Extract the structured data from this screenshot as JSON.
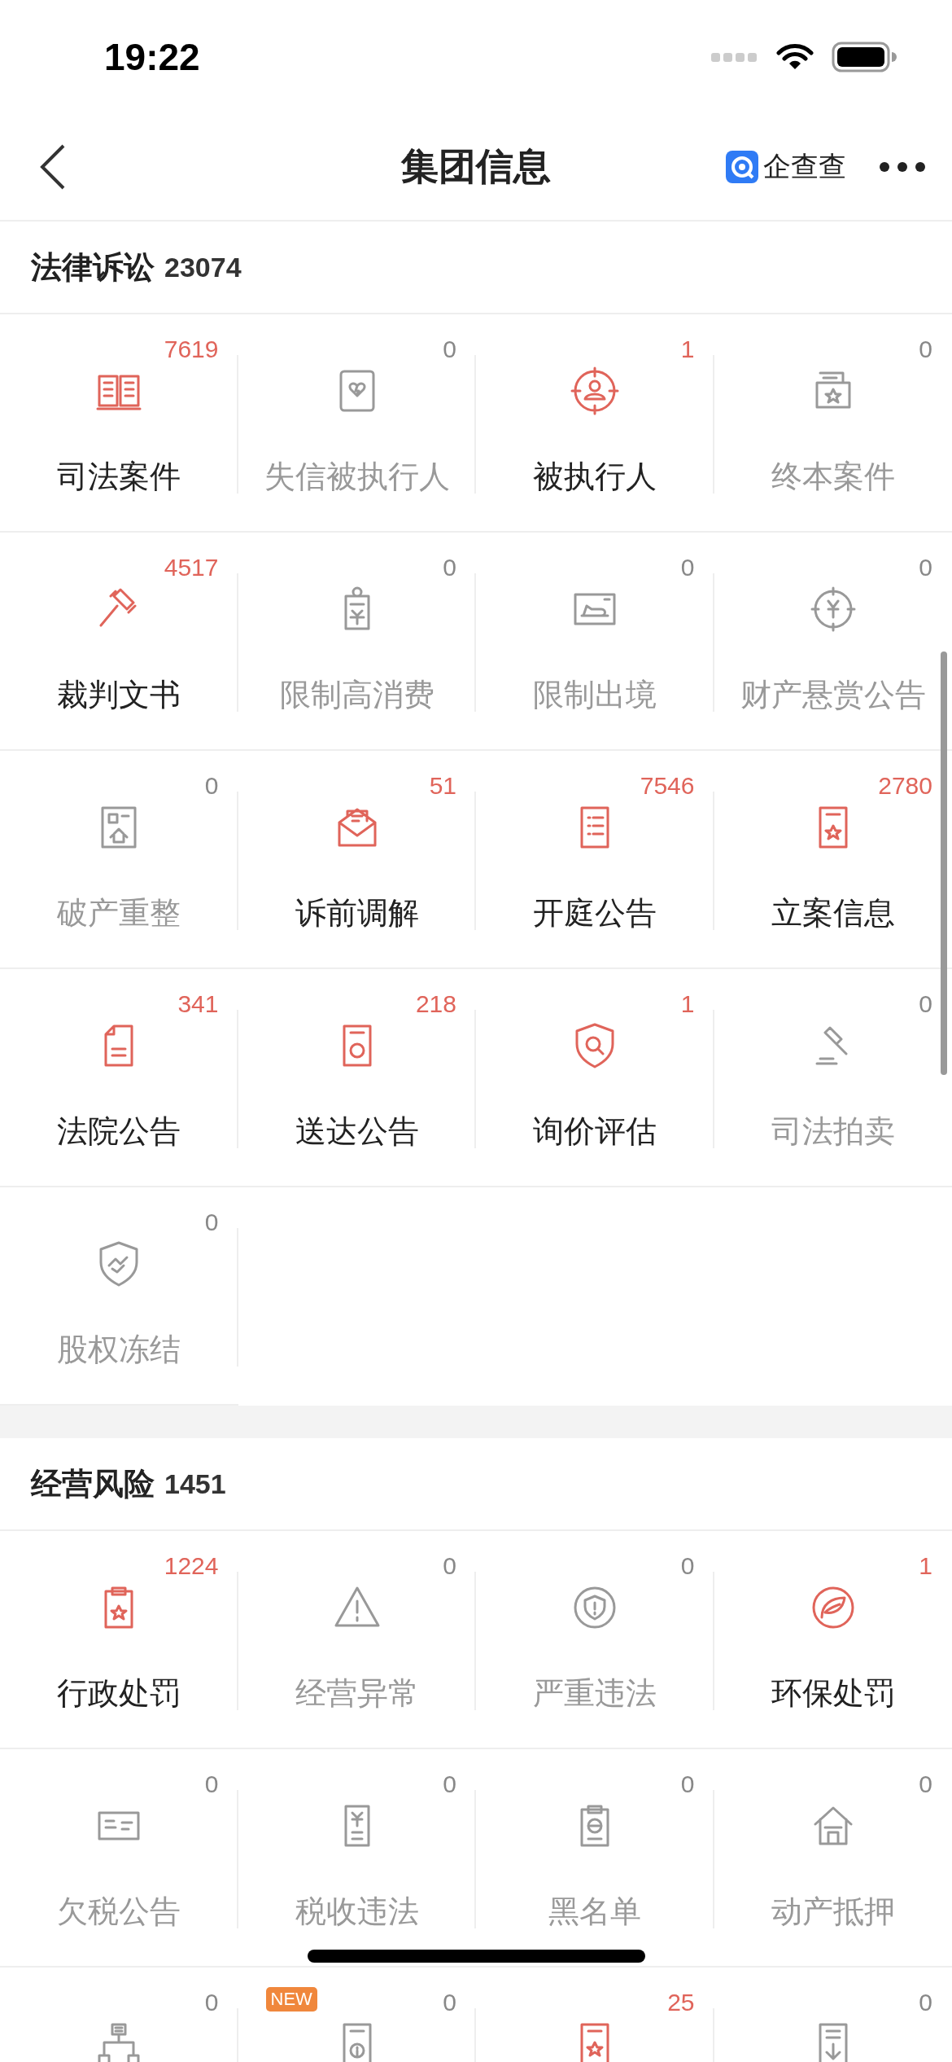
{
  "status_bar": {
    "time": "19:22"
  },
  "nav": {
    "title": "集团信息",
    "brand": "企查查"
  },
  "sections": [
    {
      "title": "法律诉讼",
      "count": "23074",
      "items": [
        {
          "label": "司法案件",
          "count": "7619",
          "active": true,
          "kind": "book"
        },
        {
          "label": "失信被执行人",
          "count": "0",
          "active": false,
          "kind": "card"
        },
        {
          "label": "被执行人",
          "count": "1",
          "active": true,
          "kind": "target"
        },
        {
          "label": "终本案件",
          "count": "0",
          "active": false,
          "kind": "folder"
        },
        {
          "label": "裁判文书",
          "count": "4517",
          "active": true,
          "kind": "gavel"
        },
        {
          "label": "限制高消费",
          "count": "0",
          "active": false,
          "kind": "badge-yen"
        },
        {
          "label": "限制出境",
          "count": "0",
          "active": false,
          "kind": "plane"
        },
        {
          "label": "财产悬赏公告",
          "count": "0",
          "active": false,
          "kind": "compass-yen"
        },
        {
          "label": "破产重整",
          "count": "0",
          "active": false,
          "kind": "building"
        },
        {
          "label": "诉前调解",
          "count": "51",
          "active": true,
          "kind": "envelope"
        },
        {
          "label": "开庭公告",
          "count": "7546",
          "active": true,
          "kind": "list"
        },
        {
          "label": "立案信息",
          "count": "2780",
          "active": true,
          "kind": "doc-star"
        },
        {
          "label": "法院公告",
          "count": "341",
          "active": true,
          "kind": "doc-fold"
        },
        {
          "label": "送达公告",
          "count": "218",
          "active": true,
          "kind": "doc-badge"
        },
        {
          "label": "询价评估",
          "count": "1",
          "active": true,
          "kind": "shield-search"
        },
        {
          "label": "司法拍卖",
          "count": "0",
          "active": false,
          "kind": "hammer"
        },
        {
          "label": "股权冻结",
          "count": "0",
          "active": false,
          "kind": "shield-hand"
        }
      ]
    },
    {
      "title": "经营风险",
      "count": "1451",
      "items": [
        {
          "label": "行政处罚",
          "count": "1224",
          "active": true,
          "kind": "clipboard-star"
        },
        {
          "label": "经营异常",
          "count": "0",
          "active": false,
          "kind": "warning"
        },
        {
          "label": "严重违法",
          "count": "0",
          "active": false,
          "kind": "circle-alert"
        },
        {
          "label": "环保处罚",
          "count": "1",
          "active": true,
          "kind": "leaf"
        },
        {
          "label": "欠税公告",
          "count": "0",
          "active": false,
          "kind": "tax-card"
        },
        {
          "label": "税收违法",
          "count": "0",
          "active": false,
          "kind": "yen-doc"
        },
        {
          "label": "黑名单",
          "count": "0",
          "active": false,
          "kind": "clipboard"
        },
        {
          "label": "动产抵押",
          "count": "0",
          "active": false,
          "kind": "house"
        },
        {
          "count": "0",
          "active": false,
          "kind": "org"
        },
        {
          "count": "0",
          "active": false,
          "kind": "doc-info",
          "badge": "NEW"
        },
        {
          "count": "25",
          "active": true,
          "kind": "doc-star"
        },
        {
          "count": "0",
          "active": false,
          "kind": "doc-download"
        }
      ]
    }
  ]
}
